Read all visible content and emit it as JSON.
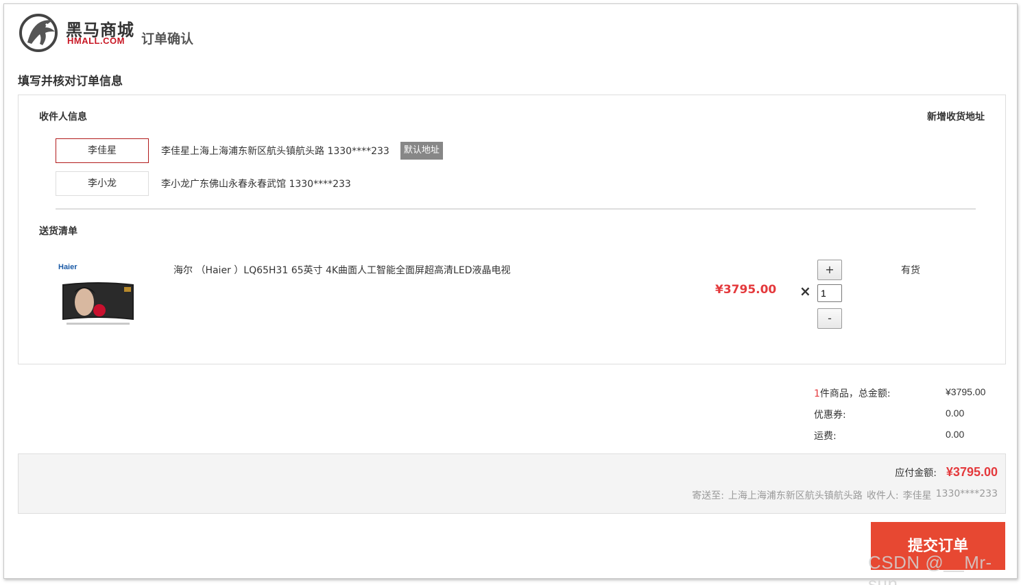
{
  "header": {
    "brand_cn": "黑马商城",
    "brand_en": "HMALL.COM",
    "page_title": "订单确认"
  },
  "section_title": "填写并核对订单信息",
  "receiver": {
    "title": "收件人信息",
    "new_address": "新增收货地址",
    "addresses": [
      {
        "name": "李佳星",
        "detail": "李佳星上海上海浦东新区航头镇航头路 1330****233",
        "badge": "默认地址",
        "selected": true
      },
      {
        "name": "李小龙",
        "detail": "李小龙广东佛山永春永春武馆 1330****233",
        "selected": false
      }
    ]
  },
  "delivery": {
    "title": "送货清单",
    "items": [
      {
        "brand": "Haier",
        "name": "海尔 （Haier ）LQ65H31 65英寸 4K曲面人工智能全面屏超高清LED液晶电视",
        "price": "¥3795.00",
        "times": "×",
        "qty_plus": "+",
        "qty": "1",
        "qty_minus": "-",
        "stock": "有货"
      }
    ]
  },
  "summary": {
    "count": "1",
    "count_suffix": "件商品，总金额:",
    "total": "¥3795.00",
    "coupon_label": "优惠券:",
    "coupon": "0.00",
    "freight_label": "运费:",
    "freight": "0.00"
  },
  "payment": {
    "label": "应付金额:",
    "amount": "¥3795.00",
    "ship_prefix": "寄送至:",
    "ship_address": "上海上海浦东新区航头镇航头路",
    "receiver_prefix": "收件人:",
    "receiver_name": "李佳星",
    "receiver_phone": "1330****233"
  },
  "submit_label": "提交订单",
  "watermark": "CSDN @__Mr-sun",
  "colors": {
    "accent_red": "#e4393c",
    "submit_bg": "#e74832",
    "selected_border": "#b1191a",
    "badge_bg": "#878787"
  }
}
